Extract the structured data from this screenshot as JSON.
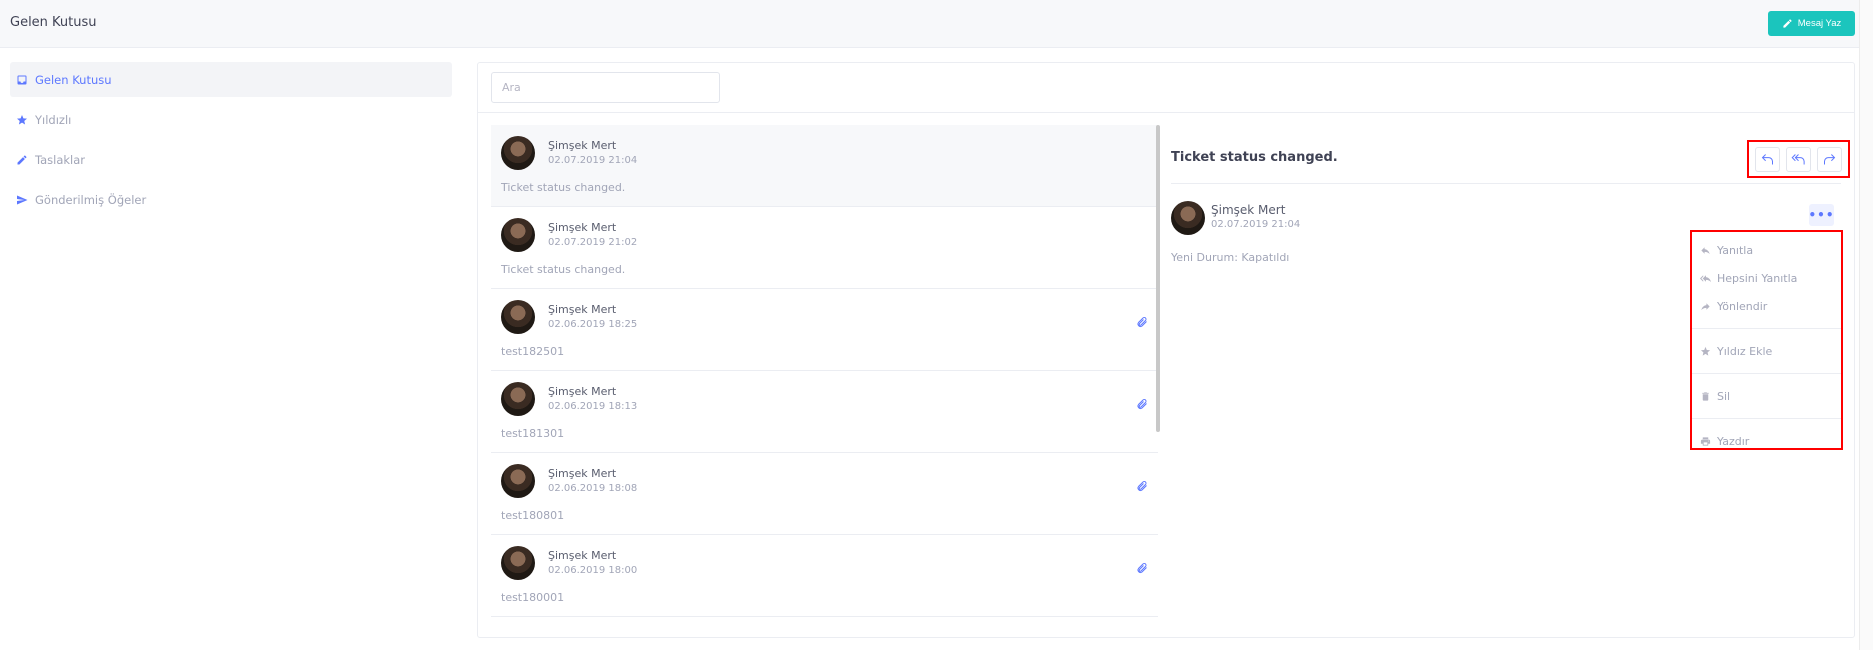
{
  "header": {
    "title": "Gelen Kutusu",
    "compose_label": "Mesaj Yaz"
  },
  "sidebar": {
    "items": [
      {
        "label": "Gelen Kutusu",
        "icon": "inbox-icon",
        "active": true
      },
      {
        "label": "Yıldızlı",
        "icon": "star-icon"
      },
      {
        "label": "Taslaklar",
        "icon": "pencil-icon"
      },
      {
        "label": "Gönderilmiş Öğeler",
        "icon": "paper-plane-icon"
      }
    ]
  },
  "search": {
    "placeholder": "Ara"
  },
  "messages": [
    {
      "from": "Şimşek Mert",
      "date": "02.07.2019 21:04",
      "preview": "Ticket status changed.",
      "attachment": false
    },
    {
      "from": "Şimşek Mert",
      "date": "02.07.2019 21:02",
      "preview": "Ticket status changed.",
      "attachment": false
    },
    {
      "from": "Şimşek Mert",
      "date": "02.06.2019 18:25",
      "preview": "test182501",
      "attachment": true
    },
    {
      "from": "Şimşek Mert",
      "date": "02.06.2019 18:13",
      "preview": "test181301",
      "attachment": true
    },
    {
      "from": "Şimşek Mert",
      "date": "02.06.2019 18:08",
      "preview": "test180801",
      "attachment": true
    },
    {
      "from": "Şimşek Mert",
      "date": "02.06.2019 18:00",
      "preview": "test180001",
      "attachment": true
    }
  ],
  "detail": {
    "subject": "Ticket status changed.",
    "from": "Şimşek Mert",
    "date": "02.07.2019 21:04",
    "body": "Yeni Durum: Kapatıldı",
    "more_label": "•••"
  },
  "dropdown": {
    "items": [
      {
        "label": "Yanıtla",
        "icon": "reply-icon"
      },
      {
        "label": "Hepsini Yanıtla",
        "icon": "reply-all-icon"
      },
      {
        "label": "Yönlendir",
        "icon": "forward-icon"
      },
      {
        "label": "Yıldız Ekle",
        "icon": "star-icon"
      },
      {
        "label": "Sil",
        "icon": "trash-icon"
      },
      {
        "label": "Yazdır",
        "icon": "print-icon"
      }
    ]
  },
  "colors": {
    "accent": "#5d78ff",
    "compose": "#1bc5bd",
    "highlight": "#ff0000"
  }
}
